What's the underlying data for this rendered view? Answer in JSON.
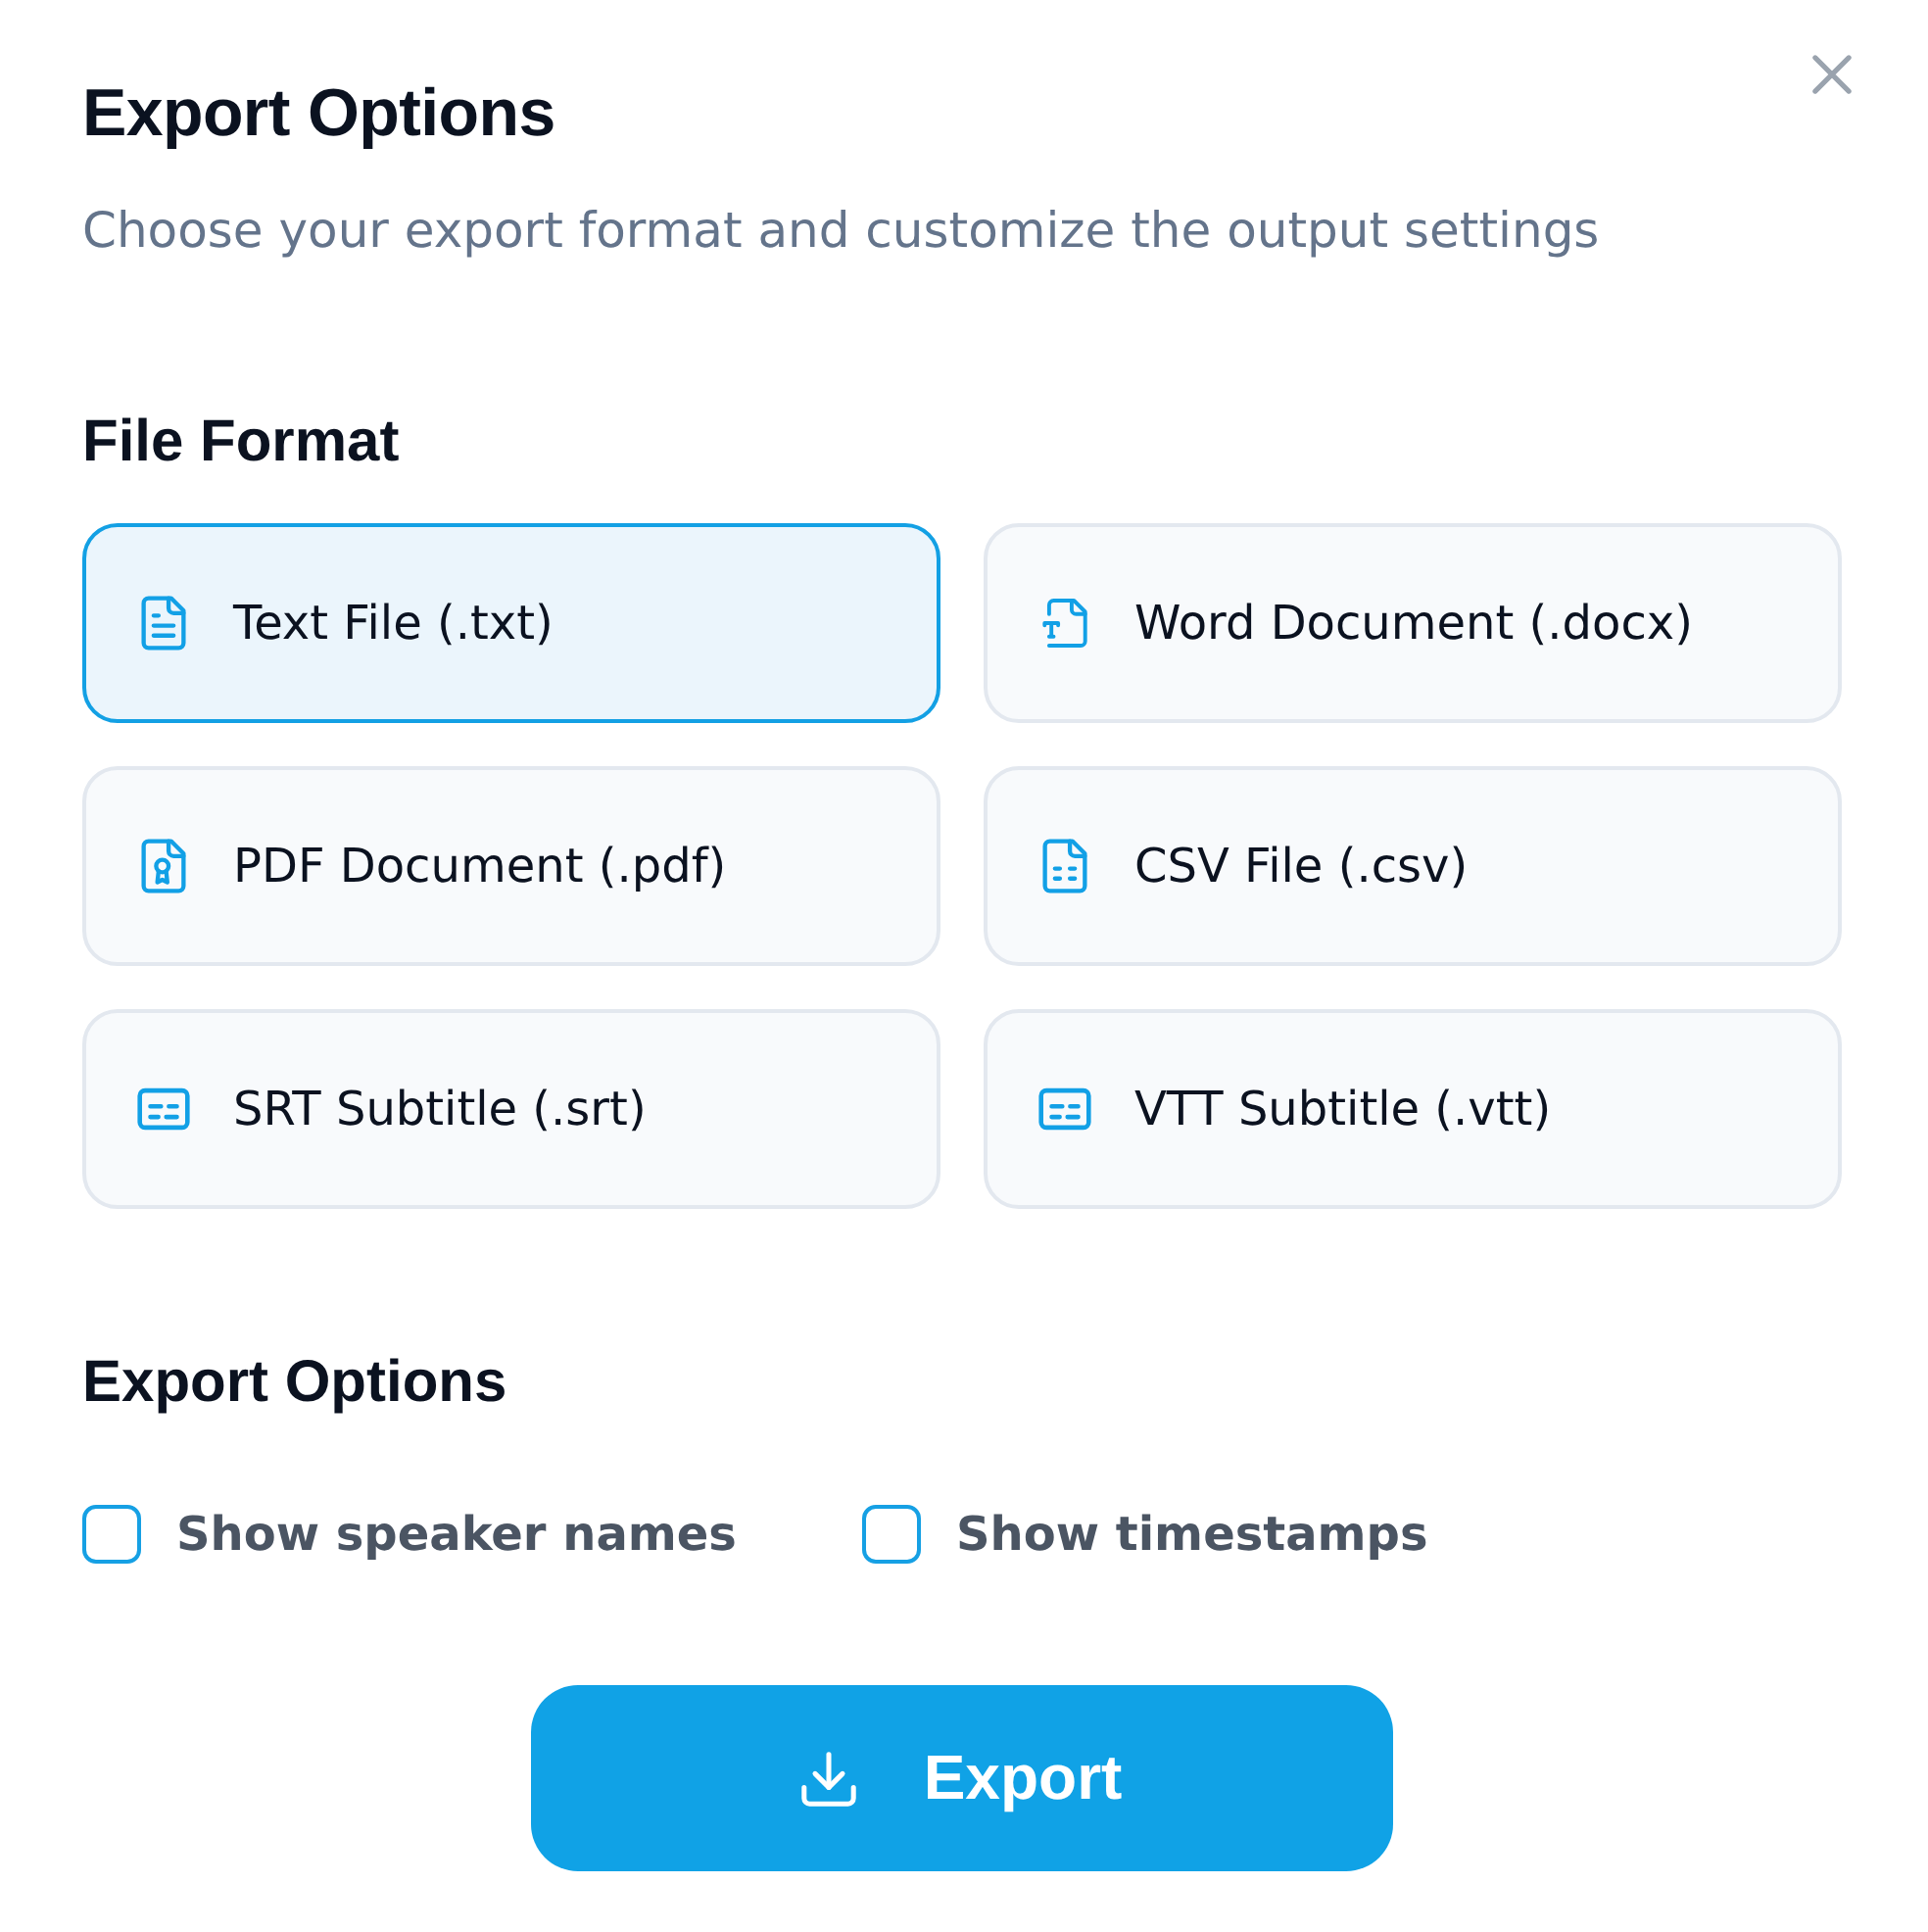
{
  "dialog": {
    "title": "Export Options",
    "subtitle": "Choose your export format and customize the output settings"
  },
  "file_format": {
    "heading": "File Format",
    "options": [
      {
        "label": "Text File (.txt)",
        "kind": "text",
        "selected": true
      },
      {
        "label": "Word Document (.docx)",
        "kind": "word",
        "selected": false
      },
      {
        "label": "PDF Document (.pdf)",
        "kind": "pdf",
        "selected": false
      },
      {
        "label": "CSV File (.csv)",
        "kind": "csv",
        "selected": false
      },
      {
        "label": "SRT Subtitle (.srt)",
        "kind": "subtitle",
        "selected": false
      },
      {
        "label": "VTT Subtitle (.vtt)",
        "kind": "subtitle",
        "selected": false
      }
    ]
  },
  "export_options": {
    "heading": "Export Options",
    "checkboxes": [
      {
        "label": "Show speaker names",
        "checked": false
      },
      {
        "label": "Show timestamps",
        "checked": false
      }
    ]
  },
  "export_button": {
    "label": "Export"
  }
}
